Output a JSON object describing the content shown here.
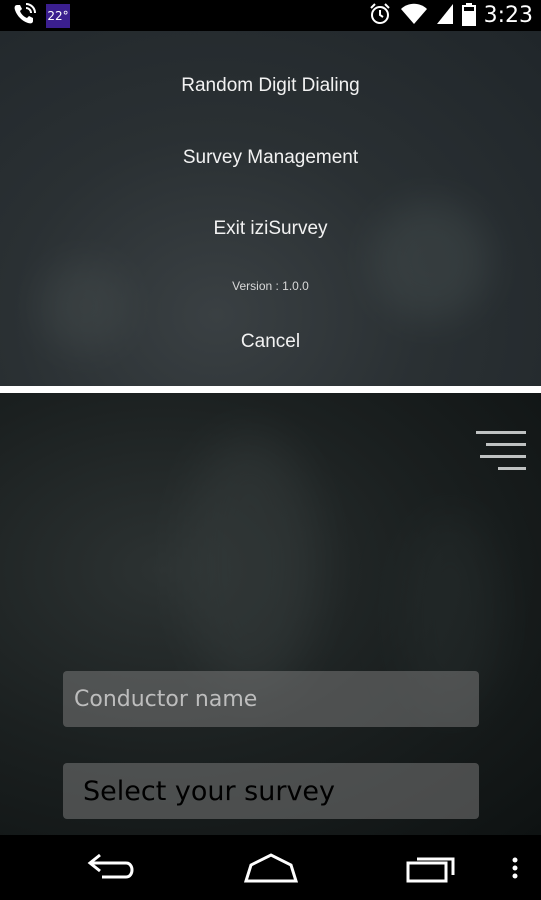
{
  "status_bar": {
    "weather": "22°",
    "time": "3:23",
    "icons": [
      "phone-icon",
      "alarm-icon",
      "wifi-icon",
      "signal-icon",
      "battery-icon"
    ]
  },
  "menu": {
    "items": [
      {
        "label": "Random Digit Dialing"
      },
      {
        "label": "Survey Management"
      },
      {
        "label": "Exit iziSurvey"
      }
    ],
    "version": "Version : 1.0.0",
    "cancel": "Cancel"
  },
  "main": {
    "menu_icon": "hamburger-menu-icon",
    "conductor_placeholder": "Conductor name",
    "survey_select_label": "Select your survey"
  },
  "nav_bar": {
    "icons": [
      "back-icon",
      "home-icon",
      "recents-icon",
      "overflow-menu-icon"
    ]
  }
}
